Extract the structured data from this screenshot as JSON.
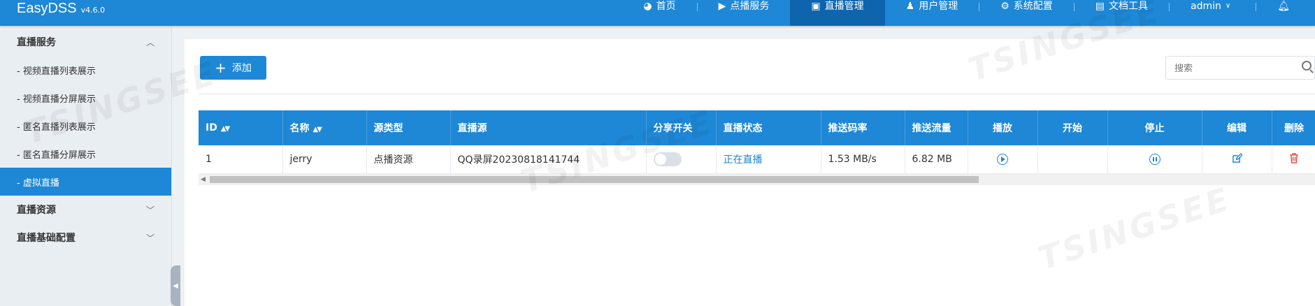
{
  "app": {
    "name": "EasyDSS",
    "version": "v4.6.0"
  },
  "nav": [
    {
      "icon": "dashboard-icon",
      "glyph": "◕",
      "label": "首页"
    },
    {
      "icon": "video-camera-icon",
      "glyph": "▶",
      "label": "点播服务"
    },
    {
      "icon": "broadcast-tv-icon",
      "glyph": "▣",
      "label": "直播管理"
    },
    {
      "icon": "user-icon",
      "glyph": "♟",
      "label": "用户管理"
    },
    {
      "icon": "gear-icon",
      "glyph": "⚙",
      "label": "系统配置"
    },
    {
      "icon": "document-icon",
      "glyph": "▤",
      "label": "文档工具"
    },
    {
      "label": "admin"
    }
  ],
  "sidebar": {
    "group1": "直播服务",
    "items": [
      "- 视频直播列表展示",
      "- 视频直播分屏展示",
      "- 匿名直播列表展示",
      "- 匿名直播分屏展示",
      "- 虚拟直播"
    ],
    "group2": "直播资源",
    "group3": "直播基础配置"
  },
  "toolbar": {
    "add_label": "添加",
    "search_placeholder": "搜索"
  },
  "table": {
    "headers": [
      "ID",
      "名称",
      "源类型",
      "直播源",
      "分享开关",
      "直播状态",
      "推送码率",
      "推送流量",
      "播放",
      "开始",
      "停止",
      "编辑",
      "删除"
    ],
    "rows": [
      {
        "id": "1",
        "name": "jerry",
        "source_type": "点播资源",
        "source": "QQ录屏20230818141744",
        "share": false,
        "status": "正在直播",
        "bitrate": "1.53 MB/s",
        "traffic": "6.82 MB"
      }
    ]
  },
  "colors": {
    "primary": "#1e87d6",
    "active_nav": "#0f65ad",
    "delete": "#e0463b"
  }
}
